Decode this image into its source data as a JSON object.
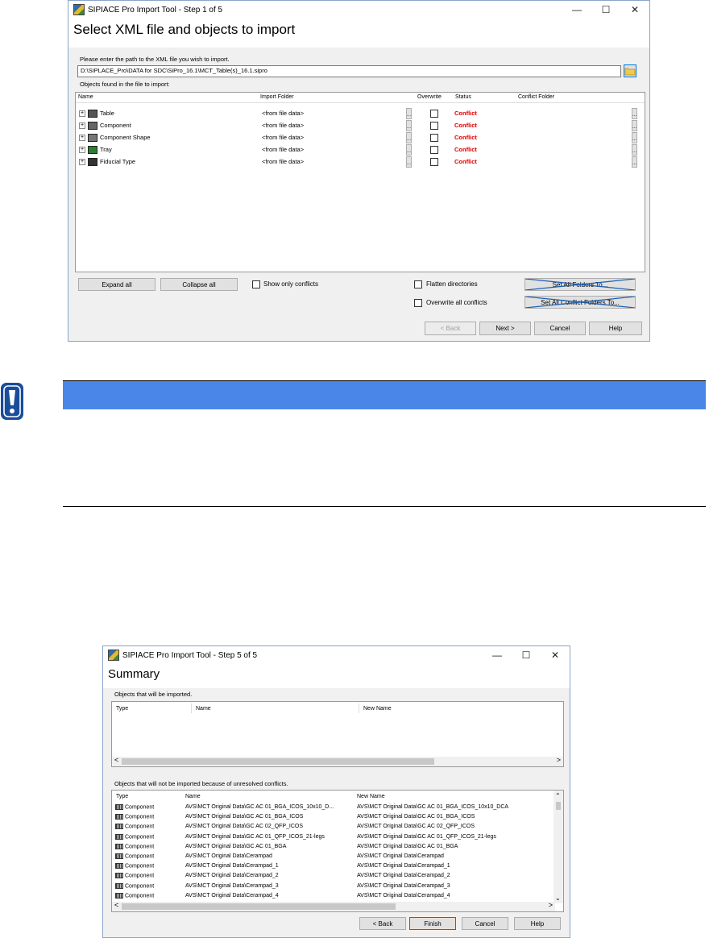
{
  "window1": {
    "title": "SIPIACE Pro Import Tool - Step 1 of 5",
    "heading": "Select XML file and objects to import",
    "path_prompt": "Please enter the path to the XML file you wish to import.",
    "path_value": "D:\\SIPLACE_Pro\\DATA for SDC\\SiPro_16.1\\MCT_Table(s)_16.1.sipro",
    "objects_label": "Objects found in the file to import:",
    "columns": {
      "name": "Name",
      "import_folder": "Import Folder",
      "overwrite": "Overwrite",
      "status": "Status",
      "conflict_folder": "Conflict Folder"
    },
    "rows": [
      {
        "name": "Table",
        "folder": "<from file data>",
        "status": "Conflict",
        "icon": "table-icon"
      },
      {
        "name": "Component",
        "folder": "<from file data>",
        "status": "Conflict",
        "icon": "component-icon"
      },
      {
        "name": "Component Shape",
        "folder": "<from file data>",
        "status": "Conflict",
        "icon": "component-shape-icon"
      },
      {
        "name": "Tray",
        "folder": "<from file data>",
        "status": "Conflict",
        "icon": "tray-icon"
      },
      {
        "name": "Fiducial Type",
        "folder": "<from file data>",
        "status": "Conflict",
        "icon": "fiducial-icon"
      }
    ],
    "expand_all": "Expand all",
    "collapse_all": "Collapse all",
    "show_only_conflicts": "Show only conflicts",
    "flatten_directories": "Flatten directories",
    "overwrite_all": "Overwrite all conflicts",
    "set_all_folders": "Set All Folders To...",
    "set_all_conflict_folders": "Set All Conflict Folders To...",
    "back": "< Back",
    "next": "Next >",
    "cancel": "Cancel",
    "help": "Help"
  },
  "window2": {
    "title": "SIPIACE Pro Import Tool - Step 5 of 5",
    "heading": "Summary",
    "imported_label": "Objects that will be imported.",
    "not_imported_label": "Objects that will not be imported because of unresolved conflicts.",
    "columns": {
      "type": "Type",
      "name": "Name",
      "new_name": "New Name"
    },
    "rows": [
      {
        "type": "Component",
        "name": "AVS\\MCT Original Data\\GC AC 01_BGA_ICOS_10x10_D...",
        "new_name": "AVS\\MCT Original Data\\GC AC 01_BGA_ICOS_10x10_DCA"
      },
      {
        "type": "Component",
        "name": "AVS\\MCT Original Data\\GC AC 01_BGA_ICOS",
        "new_name": "AVS\\MCT Original Data\\GC AC 01_BGA_ICOS"
      },
      {
        "type": "Component",
        "name": "AVS\\MCT Original Data\\GC AC 02_QFP_ICOS",
        "new_name": "AVS\\MCT Original Data\\GC AC 02_QFP_ICOS"
      },
      {
        "type": "Component",
        "name": "AVS\\MCT Original Data\\GC AC 01_QFP_ICOS_21-legs",
        "new_name": "AVS\\MCT Original Data\\GC AC 01_QFP_ICOS_21-legs"
      },
      {
        "type": "Component",
        "name": "AVS\\MCT Original Data\\GC AC 01_BGA",
        "new_name": "AVS\\MCT Original Data\\GC AC 01_BGA"
      },
      {
        "type": "Component",
        "name": "AVS\\MCT Original Data\\Cerampad",
        "new_name": "AVS\\MCT Original Data\\Cerampad"
      },
      {
        "type": "Component",
        "name": "AVS\\MCT Original Data\\Cerampad_1",
        "new_name": "AVS\\MCT Original Data\\Cerampad_1"
      },
      {
        "type": "Component",
        "name": "AVS\\MCT Original Data\\Cerampad_2",
        "new_name": "AVS\\MCT Original Data\\Cerampad_2"
      },
      {
        "type": "Component",
        "name": "AVS\\MCT Original Data\\Cerampad_3",
        "new_name": "AVS\\MCT Original Data\\Cerampad_3"
      },
      {
        "type": "Component",
        "name": "AVS\\MCT Original Data\\Cerampad_4",
        "new_name": "AVS\\MCT Original Data\\Cerampad_4"
      }
    ],
    "back": "< Back",
    "finish": "Finish",
    "cancel": "Cancel",
    "help": "Help"
  },
  "colors": {
    "accent_blue": "#4a86e8",
    "conflict_red": "#e00000",
    "note_icon": "#1a4d9c"
  }
}
